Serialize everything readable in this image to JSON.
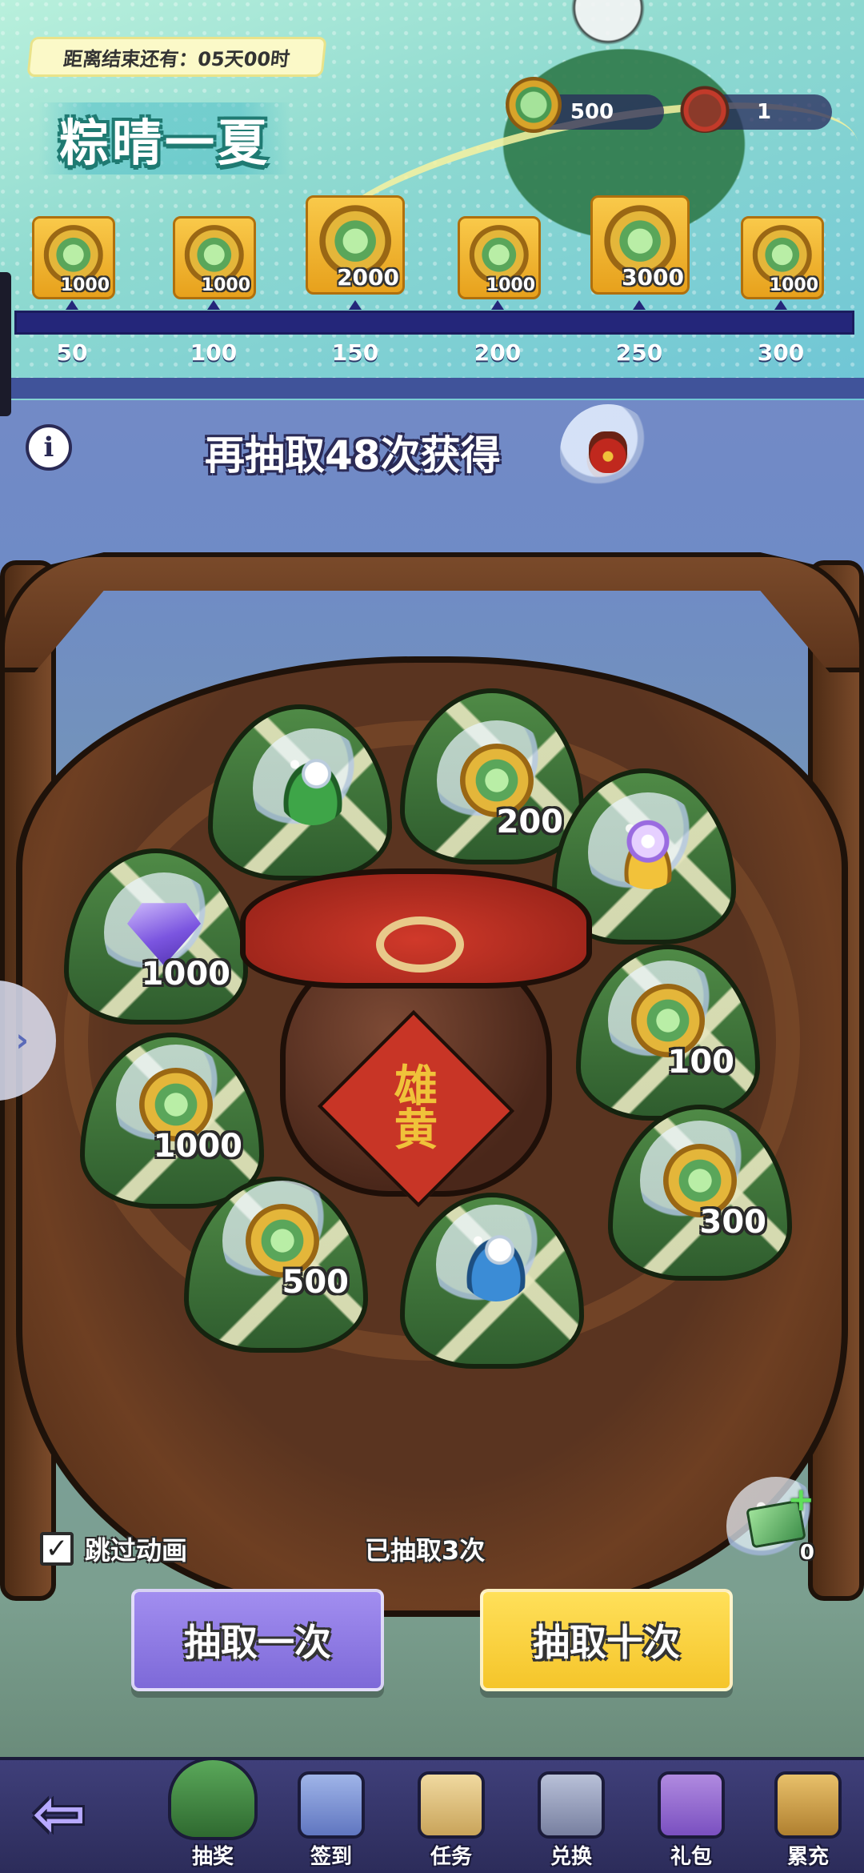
{
  "event": {
    "timer_text": "距离结束还有：05天00时",
    "title": "粽晴一夏"
  },
  "currencies": [
    {
      "icon": "zongzi-coin-icon",
      "value": "500"
    },
    {
      "icon": "realgar-jar-icon",
      "value": "1"
    }
  ],
  "milestones": {
    "progress_fraction": 0.0,
    "items": [
      {
        "threshold": "50",
        "reward": "1000"
      },
      {
        "threshold": "100",
        "reward": "1000"
      },
      {
        "threshold": "150",
        "reward": "2000"
      },
      {
        "threshold": "200",
        "reward": "1000"
      },
      {
        "threshold": "250",
        "reward": "3000"
      },
      {
        "threshold": "300",
        "reward": "1000"
      }
    ]
  },
  "draw_hint": {
    "text": "再抽取48次获得",
    "reward_icon": "realgar-jar-icon"
  },
  "basket": {
    "jar_label": "雄黄",
    "prizes": [
      {
        "icon": "green-leaf-pearl-icon",
        "qty": ""
      },
      {
        "icon": "zongzi-coin-icon",
        "qty": "200"
      },
      {
        "icon": "crystal-orb-icon",
        "qty": ""
      },
      {
        "icon": "purple-gem-icon",
        "qty": "1000"
      },
      {
        "icon": "zongzi-coin-icon",
        "qty": "100"
      },
      {
        "icon": "zongzi-coin-icon",
        "qty": "1000"
      },
      {
        "icon": "zongzi-coin-icon",
        "qty": "300"
      },
      {
        "icon": "zongzi-coin-icon",
        "qty": "500"
      },
      {
        "icon": "blue-leaf-pearl-icon",
        "qty": ""
      }
    ]
  },
  "controls": {
    "skip_label": "跳过动画",
    "skip_checked_glyph": "✓",
    "draw_count": "已抽取3次",
    "ticket_qty": "0",
    "ticket_plus": "+",
    "draw_one_label": "抽取一次",
    "draw_ten_label": "抽取十次"
  },
  "nav": {
    "back_glyph": "⇦",
    "items": [
      {
        "label": "抽奖",
        "icon": "zongzi-icon",
        "active": true
      },
      {
        "label": "签到",
        "icon": "calendar-icon",
        "active": false
      },
      {
        "label": "任务",
        "icon": "task-scroll-icon",
        "active": false
      },
      {
        "label": "兑换",
        "icon": "shop-icon",
        "active": false
      },
      {
        "label": "礼包",
        "icon": "gift-icon",
        "active": false
      },
      {
        "label": "累充",
        "icon": "treasure-chest-icon",
        "active": false
      }
    ]
  },
  "side_arrow_glyph": "›",
  "info_glyph": "i"
}
